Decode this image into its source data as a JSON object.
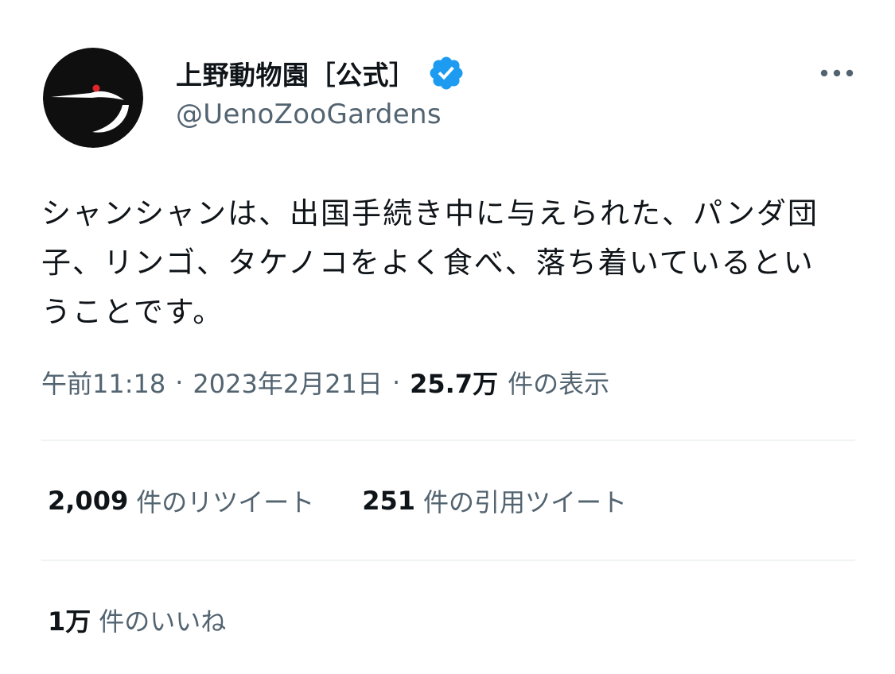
{
  "account": {
    "display_name": "上野動物園［公式］",
    "handle": "@UenoZooGardens",
    "verified_icon": "verified-badge-icon",
    "avatar_icon": "ueno-zoo-crane-logo",
    "more_icon": "more-dots-icon"
  },
  "tweet": {
    "text": "シャンシャンは、出国手続き中に与えられた、パンダ団子、リンゴ、タケノコをよく食べ、落ち着いているということです。"
  },
  "meta": {
    "time": "午前11:18",
    "separator": "·",
    "date": "2023年2月21日",
    "views_count": "25.7万",
    "views_label": "件の表示"
  },
  "stats": {
    "retweets": {
      "count": "2,009",
      "label": "件のリツイート"
    },
    "quotes": {
      "count": "251",
      "label": "件の引用ツイート"
    },
    "likes": {
      "count": "1万",
      "label": "件のいいね"
    }
  },
  "colors": {
    "text_primary": "#0f1419",
    "text_secondary": "#536471",
    "divider": "#eff3f4",
    "verified_blue": "#1d9bf0",
    "logo_red": "#e0262b"
  }
}
